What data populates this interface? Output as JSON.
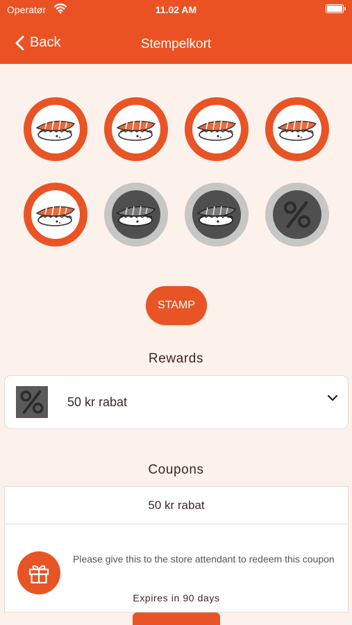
{
  "status_bar": {
    "carrier": "Operatør",
    "time": "11.02 AM"
  },
  "nav": {
    "back_label": "Back",
    "title": "Stempelkort"
  },
  "stamp_card": {
    "stamps": [
      {
        "state": "stamped",
        "icon": "sushi-icon"
      },
      {
        "state": "stamped",
        "icon": "sushi-icon"
      },
      {
        "state": "stamped",
        "icon": "sushi-icon"
      },
      {
        "state": "stamped",
        "icon": "sushi-icon"
      },
      {
        "state": "stamped",
        "icon": "sushi-icon"
      },
      {
        "state": "empty",
        "icon": "sushi-icon"
      },
      {
        "state": "empty",
        "icon": "sushi-icon"
      },
      {
        "state": "reward",
        "icon": "percent-icon"
      }
    ],
    "stamp_button_label": "STAMP"
  },
  "rewards": {
    "heading": "Rewards",
    "items": [
      {
        "label": "50 kr rabat",
        "icon": "percent-icon"
      }
    ]
  },
  "coupons": {
    "heading": "Coupons",
    "items": [
      {
        "title": "50 kr rabat",
        "description": "Please give this to the store attendant to redeem this coupon",
        "expires": "Expires in 90 days",
        "icon": "gift-icon"
      }
    ]
  },
  "colors": {
    "brand": "#EB5223",
    "background": "#FDF1EC",
    "inactive_ring": "#C6C6C6",
    "inactive_fill": "#4F4F4F"
  }
}
